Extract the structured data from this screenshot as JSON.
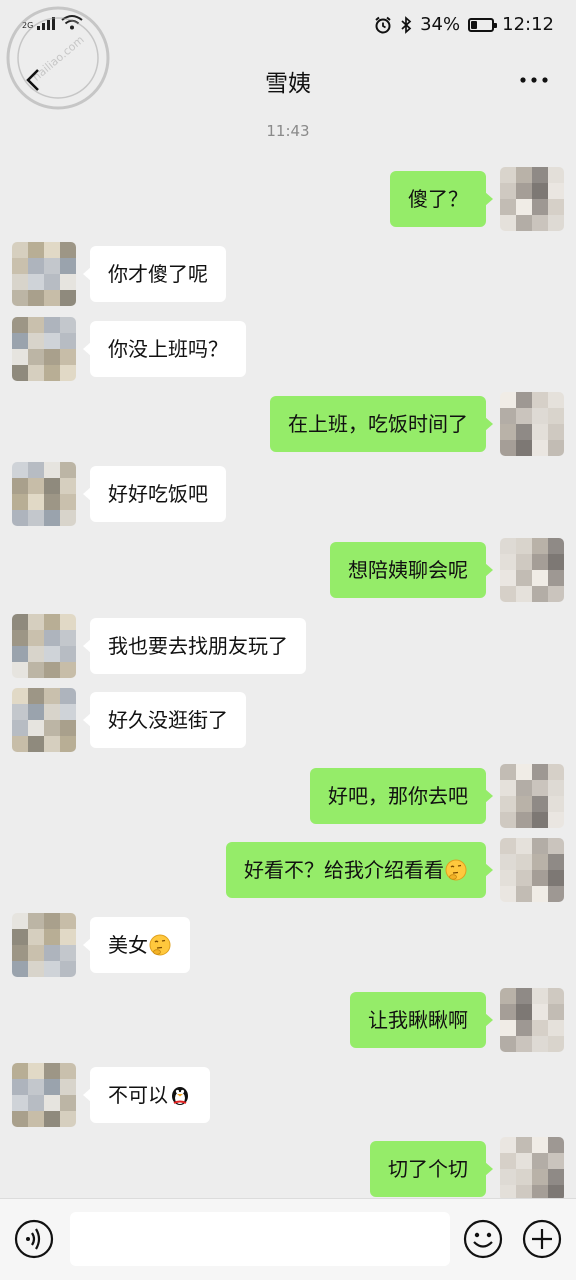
{
  "status": {
    "network": "2G",
    "battery_text": "34%",
    "battery_level": 0.34,
    "time": "12:12"
  },
  "watermark": {
    "text": "hailiao.com"
  },
  "nav": {
    "title": "雪姨"
  },
  "chat": {
    "timestamp": "11:43",
    "messages": [
      {
        "side": "out",
        "text": "傻了？"
      },
      {
        "side": "in",
        "text": "你才傻了呢"
      },
      {
        "side": "in",
        "text": "你没上班吗？"
      },
      {
        "side": "out",
        "text": "在上班，吃饭时间了"
      },
      {
        "side": "in",
        "text": "好好吃饭吧"
      },
      {
        "side": "out",
        "text": "想陪姨聊会呢"
      },
      {
        "side": "in",
        "text": "我也要去找朋友玩了"
      },
      {
        "side": "in",
        "text": "好久没逛街了"
      },
      {
        "side": "out",
        "text": "好吧，那你去吧"
      },
      {
        "side": "out",
        "text": "好看不？给我介绍看看",
        "emoji": "thinking-emoji"
      },
      {
        "side": "in",
        "text": "美女",
        "emoji": "thinking-emoji"
      },
      {
        "side": "out",
        "text": "让我瞅瞅啊"
      },
      {
        "side": "in",
        "text": "不可以",
        "emoji": "penguin-emoji"
      },
      {
        "side": "out",
        "text": "切了个切"
      }
    ]
  },
  "colors": {
    "background": "#ededed",
    "outgoing_bubble": "#95ec69",
    "incoming_bubble": "#ffffff"
  },
  "icons": {
    "back": "back-arrow-icon",
    "more": "more-dots-icon",
    "voice": "voice-icon",
    "emoji": "smiley-icon",
    "plus": "plus-icon"
  }
}
